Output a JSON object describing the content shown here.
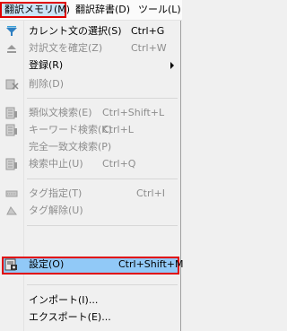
{
  "menubar": {
    "items": [
      {
        "label": "翻訳メモリ(M)",
        "active": true
      },
      {
        "label": "翻訳辞書(D)"
      },
      {
        "label": "ツール(L)"
      }
    ]
  },
  "menu": {
    "items": [
      {
        "label": "カレント文の選択(S)",
        "shortcut": "Ctrl+G",
        "icon": "funnel-icon",
        "enabled": true
      },
      {
        "label": "対訳文を確定(Z)",
        "shortcut": "Ctrl+W",
        "icon": "eject-icon",
        "enabled": false
      },
      {
        "label": "登録(R)",
        "shortcut": "",
        "icon": "",
        "enabled": true,
        "submenu": true
      },
      {
        "label": "削除(D)",
        "shortcut": "",
        "icon": "delete-icon",
        "enabled": false
      },
      {
        "label": "類似文検索(E)",
        "shortcut": "Ctrl+Shift+L",
        "icon": "search-similar-icon",
        "enabled": false
      },
      {
        "label": "キーワード検索(K)",
        "shortcut": "Ctrl+L",
        "icon": "keyword-search-icon",
        "enabled": false
      },
      {
        "label": "完全一致文検索(P)",
        "shortcut": "",
        "icon": "",
        "enabled": false
      },
      {
        "label": "検索中止(U)",
        "shortcut": "Ctrl+Q",
        "icon": "stop-search-icon",
        "enabled": false
      },
      {
        "label": "タグ指定(T)",
        "shortcut": "Ctrl+I",
        "icon": "tag-icon",
        "enabled": false
      },
      {
        "label": "タグ解除(U)",
        "shortcut": "",
        "icon": "untag-icon",
        "enabled": false
      },
      {
        "label": "設定(O)",
        "shortcut": "Ctrl+Shift+M",
        "icon": "settings-icon",
        "enabled": true,
        "highlighted": true
      },
      {
        "label": "インポート(I)...",
        "shortcut": "",
        "icon": "",
        "enabled": true
      },
      {
        "label": "エクスポート(E)...",
        "shortcut": "",
        "icon": "",
        "enabled": true
      }
    ]
  },
  "colors": {
    "highlight_bg": "#91c9f7",
    "highlight_border": "#e00000",
    "disabled_text": "#8d8d8d"
  }
}
